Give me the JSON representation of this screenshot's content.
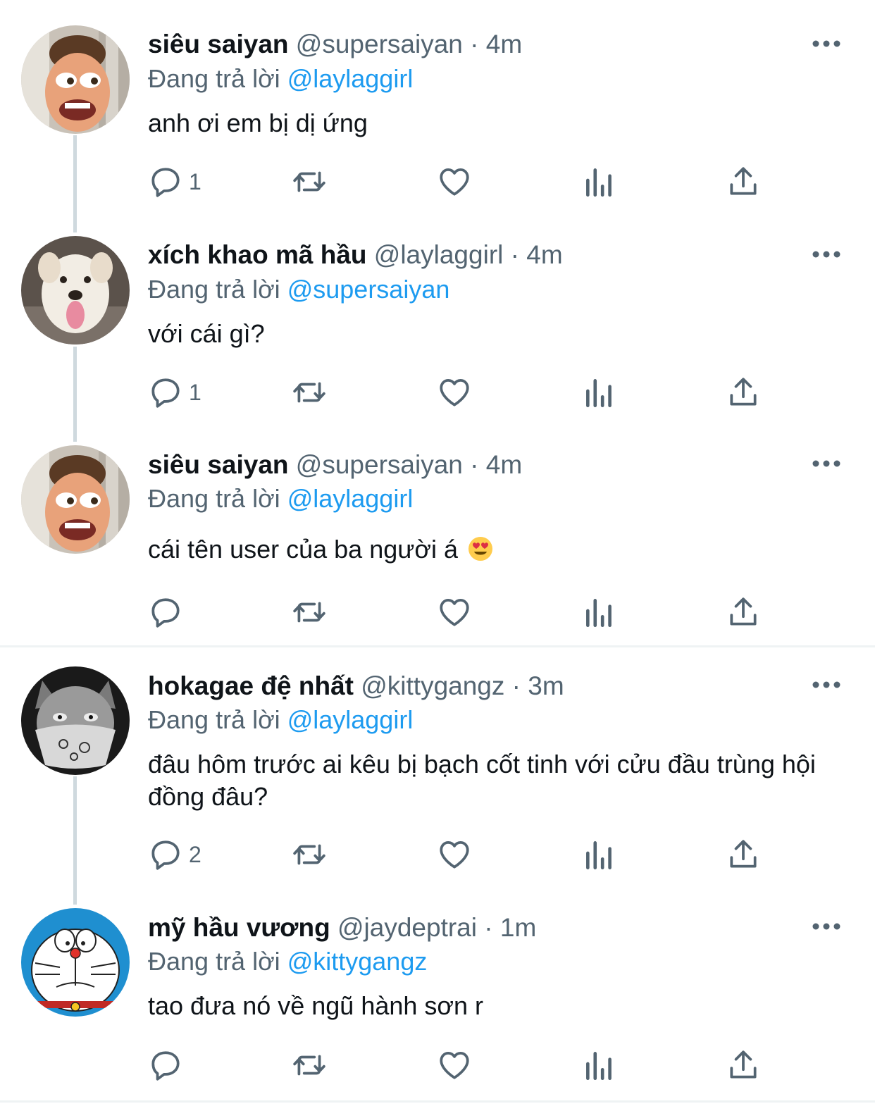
{
  "tweets": [
    {
      "name": "siêu saiyan",
      "handle": "@supersaiyan",
      "time": "4m",
      "reply_prefix": "Đang trả lời",
      "reply_to": "@laylaggirl",
      "text": "anh ơi em bị dị ứng",
      "reply_count": "1",
      "avatar_icon": "woody-face-avatar"
    },
    {
      "name": "xích khao mã hầu",
      "handle": "@laylaggirl",
      "time": "4m",
      "reply_prefix": "Đang trả lời",
      "reply_to": "@supersaiyan",
      "text": "với cái gì?",
      "reply_count": "1",
      "avatar_icon": "dog-avatar"
    },
    {
      "name": "siêu saiyan",
      "handle": "@supersaiyan",
      "time": "4m",
      "reply_prefix": "Đang trả lời",
      "reply_to": "@laylaggirl",
      "text": "cái tên user của ba người á",
      "emoji": "heart-eyes-emoji",
      "reply_count": "",
      "avatar_icon": "woody-face-avatar"
    },
    {
      "name": "hokagae đệ nhất",
      "handle": "@kittygangz",
      "time": "3m",
      "reply_prefix": "Đang trả lời",
      "reply_to": "@laylaggirl",
      "text": "đâu hôm trước ai kêu bị bạch cốt tinh với cửu đầu trùng hội đồng đâu?",
      "reply_count": "2",
      "avatar_icon": "bandana-cat-avatar"
    },
    {
      "name": "mỹ hầu vương",
      "handle": "@jaydeptrai",
      "time": "1m",
      "reply_prefix": "Đang trả lời",
      "reply_to": "@kittygangz",
      "text": "tao đưa nó về ngũ hành sơn r",
      "reply_count": "",
      "avatar_icon": "doraemon-avatar"
    }
  ],
  "separator": "·",
  "icons": {
    "reply": "reply-icon",
    "retweet": "retweet-icon",
    "like": "like-icon",
    "views": "views-icon",
    "share": "share-icon",
    "more": "more-icon"
  },
  "colors": {
    "text": "#0f1419",
    "secondary": "#536471",
    "mention": "#1d9bf0",
    "thread_line": "#cfd9de"
  }
}
